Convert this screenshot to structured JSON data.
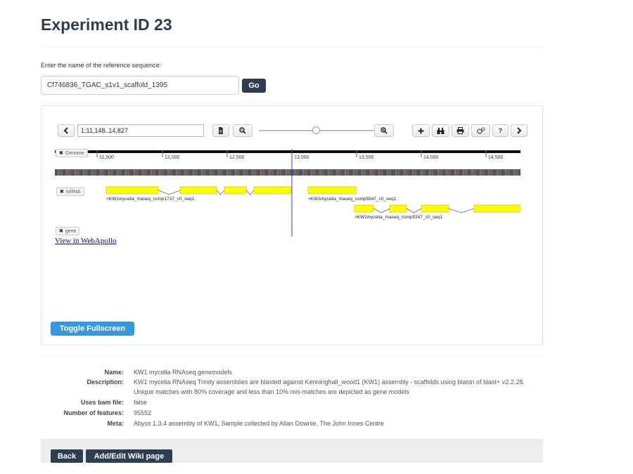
{
  "page": {
    "title": "Experiment ID 23"
  },
  "reference": {
    "label": "Enter the name of the reference sequence:",
    "value": "Cf746836_TGAC_s1v1_scaffold_1395",
    "go_label": "Go"
  },
  "browser": {
    "location": "1:11,148..14,827",
    "zoom_level_fraction": 0.44,
    "toolbar": {
      "back_icon": "chevron-left-icon",
      "file_icon": "file-icon",
      "zoom_out_icon": "zoom-out-icon",
      "zoom_in_icon": "zoom-in-icon",
      "add_icon": "plus-icon",
      "highlight_icon": "binoculars-icon",
      "print_icon": "print-icon",
      "settings_icon": "gears-icon",
      "help_label": "?",
      "forward_icon": "chevron-right-icon"
    },
    "ruler": {
      "ticks": [
        "11,500",
        "12,000",
        "12,500",
        "13,000",
        "13,500",
        "14,000",
        "14,500"
      ]
    },
    "tracks": {
      "genome": {
        "label": "Genome"
      },
      "mrna": {
        "label": "mRNA",
        "features": [
          {
            "name": "<KW1mycelia_maseq_comp1737_c0_seq1",
            "strand": "-"
          },
          {
            "name": ">KW1mycelia_maseq_comp5547_c0_seq1",
            "strand": "+"
          },
          {
            "name": ">KW1mycelia_maseq_comp5347_c0_seq1",
            "strand": "+"
          }
        ]
      },
      "gene": {
        "label": "gene"
      }
    },
    "colors": {
      "exon": "#ffff00",
      "exon_border": "#c8b400",
      "cursor_line": "#3b3bd6"
    },
    "webapollo_link": "View in WebApollo",
    "fullscreen_label": "Toggle Fullscreen"
  },
  "metadata": [
    {
      "key": "Name:",
      "value": "KW1 mycelia RNAseq genemodels"
    },
    {
      "key": "Description:",
      "value": "KW1 mycelia RNAseq Trinity assemblies are blasted against Kenninghall_wood1 (KW1) assembly - scaffolds using blastn of blast+ v2.2.28. Unique matches with 80% coverage and less than 10% mis-matches are depicted as gene models"
    },
    {
      "key": "Uses bam file:",
      "value": "false"
    },
    {
      "key": "Number of features:",
      "value": "95552"
    },
    {
      "key": "Meta:",
      "value": "Abyss 1.3.4 assembly of KW1, Sample collected by Allan Downie, The John Innes Centre"
    }
  ],
  "footer": {
    "back_label": "Back",
    "wiki_label": "Add/Edit Wiki page"
  }
}
